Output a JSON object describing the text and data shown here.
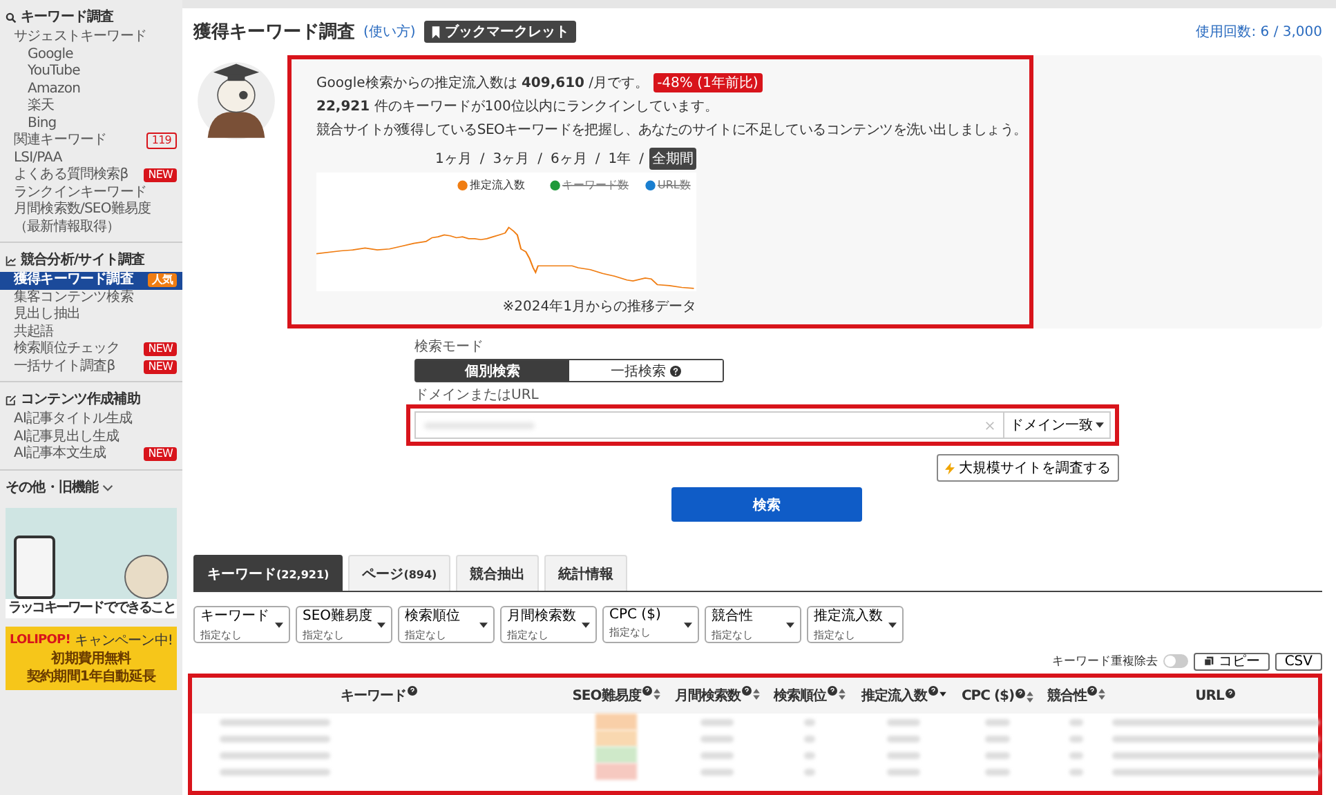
{
  "sidebar": {
    "sections": [
      {
        "title": "キーワード調査",
        "items": [
          {
            "label": "サジェストキーワード",
            "selected": false,
            "children": [
              {
                "label": "Google",
                "selected": false
              },
              {
                "label": "YouTube",
                "selected": false
              },
              {
                "label": "Amazon",
                "selected": false
              },
              {
                "label": "楽天",
                "selected": false
              },
              {
                "label": "Bing",
                "selected": false
              }
            ]
          },
          {
            "label": "関連キーワード",
            "selected": false,
            "badge": {
              "kind": "count",
              "text": "119"
            }
          },
          {
            "label": "LSI/PAA",
            "selected": false
          },
          {
            "label": "よくある質問検索β",
            "selected": false,
            "badge": {
              "kind": "new",
              "text": "NEW"
            }
          },
          {
            "label": "ランクインキーワード",
            "selected": false
          },
          {
            "label": "月間検索数/SEO難易度（最新情報取得）",
            "selected": false
          }
        ]
      },
      {
        "title": "競合分析/サイト調査",
        "items": [
          {
            "label": "獲得キーワード調査",
            "selected": true,
            "badge": {
              "kind": "popular",
              "text": "人気"
            }
          },
          {
            "label": "集客コンテンツ検索",
            "selected": false
          },
          {
            "label": "見出し抽出",
            "selected": false
          },
          {
            "label": "共起語",
            "selected": false
          },
          {
            "label": "検索順位チェック",
            "selected": false,
            "badge": {
              "kind": "new",
              "text": "NEW"
            }
          },
          {
            "label": "一括サイト調査β",
            "selected": false,
            "badge": {
              "kind": "new",
              "text": "NEW"
            }
          }
        ]
      },
      {
        "title": "コンテンツ作成補助",
        "items": [
          {
            "label": "AI記事タイトル生成",
            "selected": false
          },
          {
            "label": "AI記事見出し生成",
            "selected": false
          },
          {
            "label": "AI記事本文生成",
            "selected": false,
            "badge": {
              "kind": "new",
              "text": "NEW"
            }
          }
        ]
      }
    ],
    "more": {
      "label": "その他・旧機能",
      "expanded": false
    },
    "banners": [
      {
        "kind": "feature",
        "caption": "ラッコキーワードでできること"
      },
      {
        "kind": "campaign",
        "brand": "LOLIPOP!",
        "tag": "キャンペーン中!",
        "lines": [
          "初期費用無料",
          "契約期間1年自動延長"
        ]
      }
    ]
  },
  "header": {
    "title": "獲得キーワード調査",
    "help_link": "(使い方)",
    "bookmarklet": "ブックマークレット",
    "usage": "使用回数: 6 / 3,000"
  },
  "summary": {
    "line1": "Google検索からの推定流入数は **409,610** /月です。",
    "change_badge": "-48% (1年前比)",
    "line2": "**22,921** 件のキーワードが100位以内にランクインしています。",
    "line3": "競合サイトが獲得しているSEOキーワードを把握し、あなたのサイトに不足しているコンテンツを洗い出しましょう。",
    "period_separator": "/",
    "periods": [
      {
        "label": "1ヶ月",
        "selected": false
      },
      {
        "label": "3ヶ月",
        "selected": false
      },
      {
        "label": "6ヶ月",
        "selected": false
      },
      {
        "label": "1年",
        "selected": false
      },
      {
        "label": "全期間",
        "selected": true
      }
    ],
    "legend": [
      {
        "label": "推定流入数",
        "color": "#f07d12",
        "hidden": false
      },
      {
        "label": "キーワード数",
        "color": "#1f9a3a",
        "hidden": true
      },
      {
        "label": "URL数",
        "color": "#1a7fd0",
        "hidden": true
      }
    ],
    "note": "※2024年1月からの推移データ"
  },
  "search": {
    "mode_label": "検索モード",
    "modes": [
      {
        "label": "個別検索",
        "selected": true,
        "help": false
      },
      {
        "label": "一括検索",
        "selected": false,
        "help": true
      }
    ],
    "domain_label": "ドメインまたはURL",
    "match_dropdown": "ドメイン一致",
    "large_site_button": "大規模サイトを調査する",
    "submit": "検索"
  },
  "tabs": [
    {
      "label": "キーワード",
      "count": "(22,921)",
      "selected": true
    },
    {
      "label": "ページ",
      "count": "(894)",
      "selected": false
    },
    {
      "label": "競合抽出",
      "selected": false
    },
    {
      "label": "統計情報",
      "selected": false
    }
  ],
  "filters": [
    {
      "label": "キーワード",
      "value": "指定なし"
    },
    {
      "label": "SEO難易度",
      "value": "指定なし"
    },
    {
      "label": "検索順位",
      "value": "指定なし"
    },
    {
      "label": "月間検索数",
      "value": "指定なし"
    },
    {
      "label": "CPC ($)",
      "value": "指定なし"
    },
    {
      "label": "競合性",
      "value": "指定なし"
    },
    {
      "label": "推定流入数",
      "value": "指定なし"
    }
  ],
  "toolbar": {
    "dedupe_label": "キーワード重複除去",
    "dedupe_on": false,
    "copy": "コピー",
    "csv": "CSV"
  },
  "table": {
    "columns": [
      {
        "label": "キーワード",
        "help": true,
        "sortable": false
      },
      {
        "label": "SEO難易度",
        "help": true,
        "sortable": true,
        "sorted": false
      },
      {
        "label": "月間検索数",
        "help": true,
        "sortable": true,
        "sorted": false
      },
      {
        "label": "検索順位",
        "help": true,
        "sortable": true,
        "sorted": false
      },
      {
        "label": "推定流入数",
        "help": true,
        "sortable": true,
        "sorted": true
      },
      {
        "label": "CPC ($)",
        "help": true,
        "sortable": true,
        "sorted": false
      },
      {
        "label": "競合性",
        "help": true,
        "sortable": true,
        "sorted": false
      },
      {
        "label": "URL",
        "help": true,
        "sortable": false
      }
    ],
    "blurred_rows": [
      {
        "color": "#f9cfa8"
      },
      {
        "color": "#f9d8b0"
      },
      {
        "color": "#cfe9c9"
      },
      {
        "color": "#f6c9c0"
      }
    ]
  }
}
